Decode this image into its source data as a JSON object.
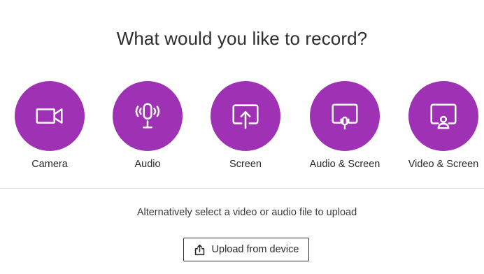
{
  "heading": "What would you like to record?",
  "options": [
    {
      "label": "Camera",
      "icon": "camera-icon"
    },
    {
      "label": "Audio",
      "icon": "microphone-icon"
    },
    {
      "label": "Screen",
      "icon": "screen-share-icon"
    },
    {
      "label": "Audio & Screen",
      "icon": "screen-microphone-icon"
    },
    {
      "label": "Video & Screen",
      "icon": "screen-person-icon"
    }
  ],
  "alternative_text": "Alternatively select a video or audio file to upload",
  "upload_button": {
    "label": "Upload from device",
    "icon": "upload-icon"
  },
  "colors": {
    "accent": "#9e31b4",
    "text": "#2e2e2e",
    "divider": "#e3e3e3"
  }
}
